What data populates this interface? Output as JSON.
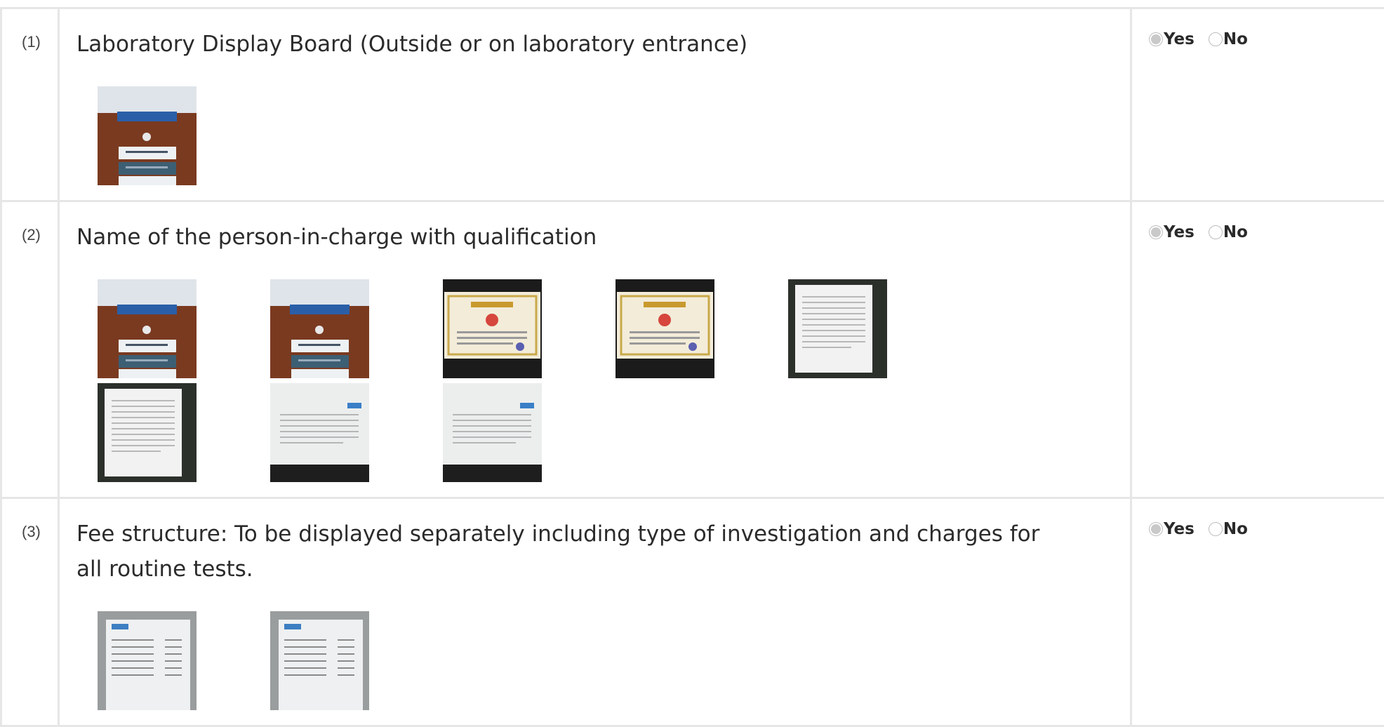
{
  "items": [
    {
      "serial": "(1)",
      "title": "Laboratory Display Board (Outside or on laboratory entrance)",
      "answer": "Yes",
      "options": [
        "Yes",
        "No"
      ],
      "thumbnails": [
        "door-sign-photo"
      ]
    },
    {
      "serial": "(2)",
      "title": "Name of the person-in-charge with qualification",
      "answer": "Yes",
      "options": [
        "Yes",
        "No"
      ],
      "thumbnails": [
        "door-sign-photo",
        "door-sign-photo",
        "certificate-photo",
        "certificate-photo",
        "document-photo",
        "document-photo",
        "letter-photo",
        "letter-photo"
      ]
    },
    {
      "serial": "(3)",
      "title": "Fee structure: To be displayed separately including type of investigation and charges for all routine tests.",
      "answer": "Yes",
      "options": [
        "Yes",
        "No"
      ],
      "thumbnails": [
        "fee-chart-photo",
        "fee-chart-photo"
      ]
    }
  ]
}
